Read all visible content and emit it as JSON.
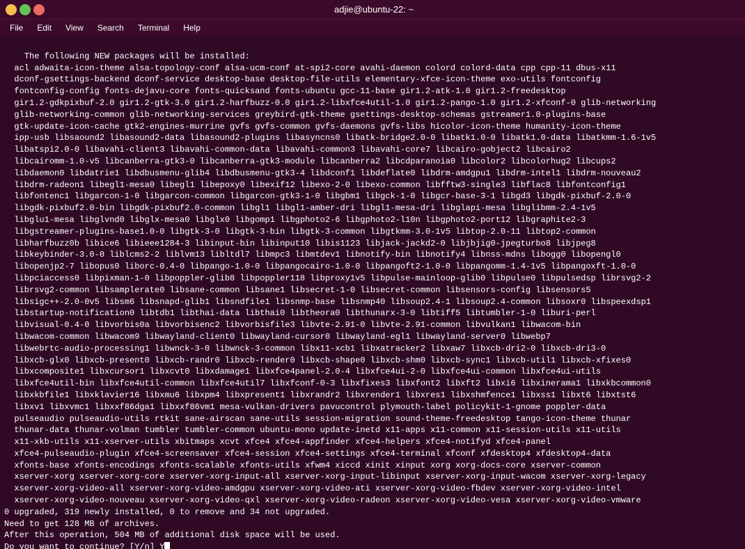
{
  "titlebar": {
    "title": "adjie@ubuntu-22: ~",
    "minimize_label": "minimize",
    "maximize_label": "maximize",
    "close_label": "close"
  },
  "menubar": {
    "items": [
      "File",
      "Edit",
      "View",
      "Search",
      "Terminal",
      "Help"
    ]
  },
  "terminal": {
    "content": "The following NEW packages will be installed:\n  acl adwaita-icon-theme alsa-topology-conf alsa-ucm-conf at-spi2-core avahi-daemon colord colord-data cpp cpp-11 dbus-x11\n  dconf-gsettings-backend dconf-service desktop-base desktop-file-utils elementary-xfce-icon-theme exo-utils fontconfig\n  fontconfig-config fonts-dejavu-core fonts-quicksand fonts-ubuntu gcc-11-base gir1.2-atk-1.0 gir1.2-freedesktop\n  gir1.2-gdkpixbuf-2.0 gir1.2-gtk-3.0 gir1.2-harfbuzz-0.0 gir1.2-libxfce4util-1.0 gir1.2-pango-1.0 gir1.2-xfconf-0 glib-networking\n  glib-networking-common glib-networking-services greybird-gtk-theme gsettings-desktop-schemas gstreamer1.0-plugins-base\n  gtk-update-icon-cache gtk2-engines-murrine gvfs gvfs-common gvfs-daemons gvfs-libs hicolor-icon-theme humanity-icon-theme\n  ipp-usb libsaound2 libasound2-data libasound2-plugins libasyncns0 libatk-bridge2.0-0 libatk1.0-0 libatk1.0-data libatkmm-1.6-1v5\n  libatspi2.0-0 libavahi-client3 libavahi-common-data libavahi-common3 libavahi-core7 libcairo-gobject2 libcairo2\n  libcairomm-1.0-v5 libcanberra-gtk3-0 libcanberra-gtk3-module libcanberra2 libcdparanoia0 libcolor2 libcolorhug2 libcups2\n  libdaemon0 libdatrie1 libdbusmenu-glib4 libdbusmenu-gtk3-4 libdconf1 libdeflate0 libdrm-amdgpu1 libdrm-intel1 libdrm-nouveau2\n  libdrm-radeon1 libegl1-mesa0 libegl1 libepoxy0 libexif12 libexo-2-0 libexo-common libfftw3-single3 libflac8 libfontconfig1\n  libfontenc1 libgarcon-1-0 libgarcon-common libgarcon-gtk3-1-0 libgbm1 libgck-1-0 libgcr-base-3-1 libgd3 libgdk-pixbuf-2.0-0\n  libgdk-pixbuf2.0-bin libgdk-pixbuf2.0-common libgl1 libgl1-amber-dri libgl1-mesa-dri libglapi-mesa libglibmm-2.4-1v5\n  libglu1-mesa libglvnd0 libglx-mesa0 libglx0 libgomp1 libgphoto2-6 libgphoto2-l10n libgphoto2-port12 libgraphite2-3\n  libgstreamer-plugins-base1.0-0 libgtk-3-0 libgtk-3-bin libgtk-3-common libgtkmm-3.0-1v5 libtop-2.0-11 libtop2-common\n  libharfbuzz0b libice6 libieee1284-3 libinput-bin libinput10 libis1123 libjack-jackd2-0 libjbjig0-jpegturbo8 libjpeg8\n  libkeybinder-3.0-0 liblcms2-2 liblvm13 libltdl7 libmpc3 libmtdev1 libnotify-bin libnotify4 libnss-mdns libogg0 libopengl0\n  libopenjp2-7 libopus0 liborc-0.4-0 libpango-1.0-0 libpangocairo-1.0-0 libpangoft2-1.0-0 libpangomm-1.4-1v5 libpangoxft-1.0-0\n  libpciaccess0 libpixman-1-0 libpoppler-glib8 libpoppler118 libproxy1v5 libpulse-mainloop-glib0 libpulse0 libpulsedsp librsvg2-2\n  librsvg2-common libsamplerate0 libsane-common libsane1 libsecret-1-0 libsecret-common libsensors-config libsensors5\n  libsigc++-2.0-0v5 libsm6 libsnapd-glib1 libsndfile1 libsnmp-base libsnmp40 libsoup2.4-1 libsoup2.4-common libsoxr0 libspeexdsp1\n  libstartup-notification0 libtdb1 libthai-data libthai0 libtheora0 libthunarx-3-0 libtiff5 libtumbler-1-0 liburi-perl\n  libvisual-0.4-0 libvorbis0a libvorbisenc2 libvorbisfile3 libvte-2.91-0 libvte-2.91-common libvulkan1 libwacom-bin\n  libwacom-common libwacom9 libwayland-client0 libwayland-cursor0 libwayland-egl1 libwayland-server0 libwebp7\n  libwebrtc-audio-processing1 libwnck-3-0 libwnck-3-common libx11-xcb1 libxatracker2 libxaw7 libxcb-dri2-0 libxcb-dri3-0\n  libxcb-glx0 libxcb-present0 libxcb-randr0 libxcb-render0 libxcb-shape0 libxcb-shm0 libxcb-sync1 libxcb-util1 libxcb-xfixes0\n  libxcomposite1 libxcursor1 libxcvt0 libxdamage1 libxfce4panel-2.0-4 libxfce4ui-2-0 libxfce4ui-common libxfce4ui-utils\n  libxfce4util-bin libxfce4util-common libxfce4util7 libxfconf-0-3 libxfixes3 libxfont2 libxft2 libxi6 libxinerama1 libxkbcommon0\n  libxkbfile1 libxklavier16 libxmu6 libxpm4 libxpresent1 libxrandr2 libxrender1 libxres1 libxshmfence1 libxss1 libxt6 libxtst6\n  libxv1 libxvmc1 libxxf86dga1 libxxf86vm1 mesa-vulkan-drivers pavucontrol plymouth-label policykit-1-gnome poppler-data\n  pulseaudio pulseaudio-utils rtkit sane-airscan sane-utils session-migration sound-theme-freedesktop tango-icon-theme thunar\n  thunar-data thunar-volman tumbler tumbler-common ubuntu-mono update-inetd x11-apps x11-common x11-session-utils x11-utils\n  x11-xkb-utils x11-xserver-utils xbitmaps xcvt xfce4 xfce4-appfinder xfce4-helpers xfce4-notifyd xfce4-panel\n  xfce4-pulseaudio-plugin xfce4-screensaver xfce4-session xfce4-settings xfce4-terminal xfconf xfdesktop4 xfdesktop4-data\n  xfonts-base xfonts-encodings xfonts-scalable xfonts-utils xfwm4 xiccd xinit xinput xorg xorg-docs-core xserver-common\n  xserver-xorg xserver-xorg-core xserver-xorg-input-all xserver-xorg-input-libinput xserver-xorg-input-wacom xserver-xorg-legacy\n  xserver-xorg-video-all xserver-xorg-video-amdgpu xserver-xorg-video-ati xserver-xorg-video-fbdev xserver-xorg-video-intel\n  xserver-xorg-video-nouveau xserver-xorg-video-qxl xserver-xorg-video-radeon xserver-xorg-video-vesa xserver-xorg-video-vmware\n0 upgraded, 319 newly installed, 0 to remove and 34 not upgraded.\nNeed to get 128 MB of archives.\nAfter this operation, 504 MB of additional disk space will be used.\nDo you want to continue? [Y/n] Y"
  }
}
